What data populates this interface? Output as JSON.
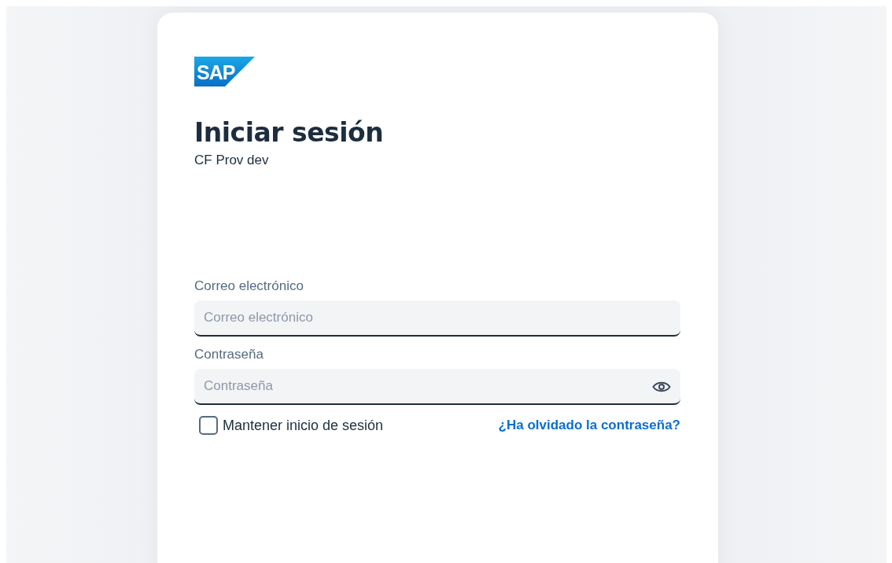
{
  "logo": "SAP",
  "title": "Iniciar sesión",
  "subtitle": "CF Prov dev",
  "fields": [
    {
      "kind": "email",
      "label": "Correo electrónico",
      "placeholder": "Correo electrónico"
    },
    {
      "kind": "password",
      "label": "Contraseña",
      "placeholder": "Contraseña"
    }
  ],
  "remember": {
    "label": "Mantener inicio de sesión",
    "checked": false
  },
  "forgot_link": "¿Ha olvidado la contraseña?"
}
